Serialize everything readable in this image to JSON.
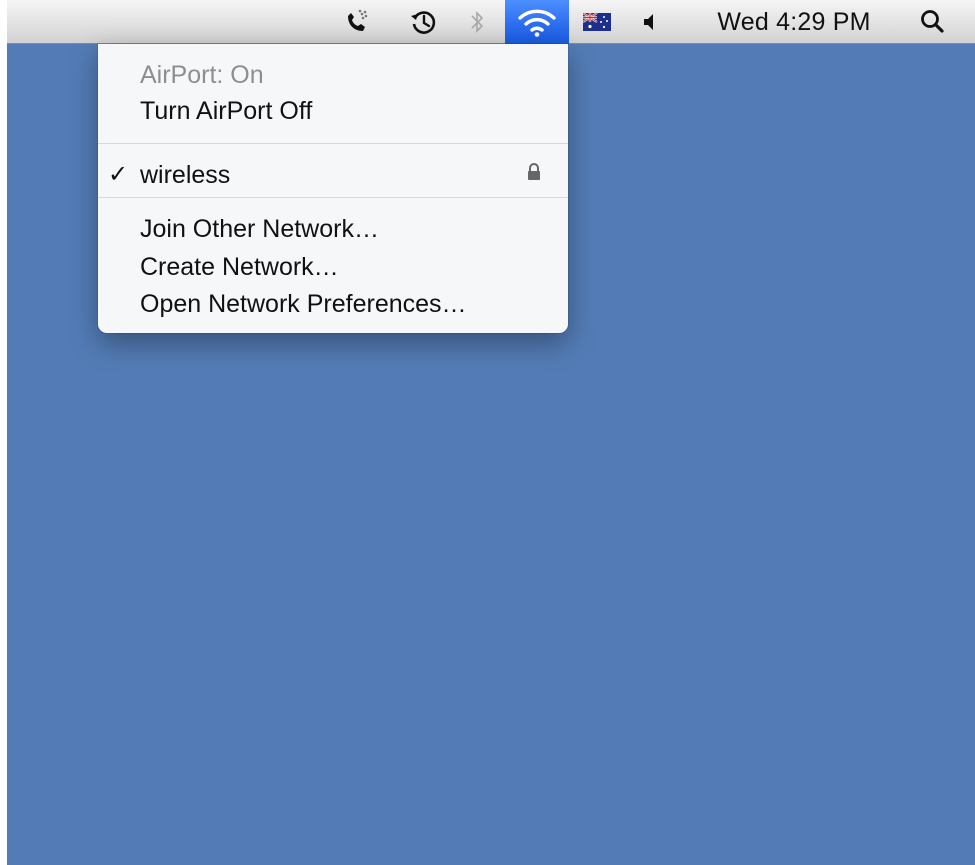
{
  "menubar": {
    "icons": {
      "phone": "phone-signal-icon",
      "time_machine": "time-machine-icon",
      "bluetooth": "bluetooth-icon",
      "wifi": "wifi-icon",
      "input_source": "australia-flag-icon",
      "volume": "volume-icon",
      "spotlight": "spotlight-search-icon"
    },
    "clock": "Wed 4:29 PM"
  },
  "airport_menu": {
    "status": "AirPort: On",
    "toggle": "Turn AirPort Off",
    "networks": [
      {
        "name": "wireless",
        "selected": true,
        "secured": true
      }
    ],
    "actions": [
      "Join Other Network…",
      "Create Network…",
      "Open Network Preferences…"
    ]
  },
  "colors": {
    "desktop": "#537cb6",
    "wifi_highlight": "#2d6ef0"
  }
}
